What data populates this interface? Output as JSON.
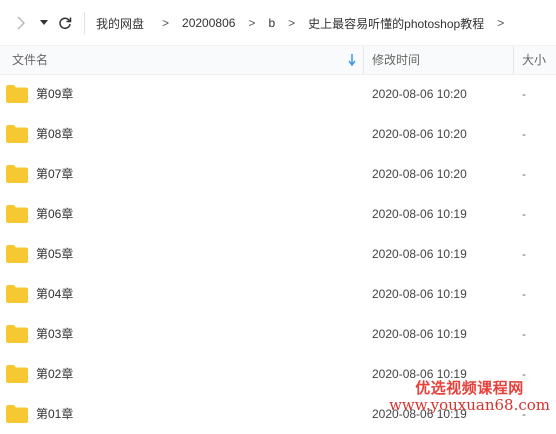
{
  "toolbar": {
    "forward_icon": "chevron-right-icon",
    "dropdown_icon": "caret-down-icon",
    "refresh_icon": "refresh-icon"
  },
  "breadcrumb": {
    "items": [
      "我的网盘",
      "20200806",
      "b",
      "史上最容易听懂的photoshop教程"
    ],
    "separator": ">"
  },
  "columns": {
    "name": "文件名",
    "modified": "修改时间",
    "size": "大小"
  },
  "files": [
    {
      "name": "第09章",
      "modified": "2020-08-06 10:20",
      "size": "-"
    },
    {
      "name": "第08章",
      "modified": "2020-08-06 10:20",
      "size": "-"
    },
    {
      "name": "第07章",
      "modified": "2020-08-06 10:20",
      "size": "-"
    },
    {
      "name": "第06章",
      "modified": "2020-08-06 10:19",
      "size": "-"
    },
    {
      "name": "第05章",
      "modified": "2020-08-06 10:19",
      "size": "-"
    },
    {
      "name": "第04章",
      "modified": "2020-08-06 10:19",
      "size": "-"
    },
    {
      "name": "第03章",
      "modified": "2020-08-06 10:19",
      "size": "-"
    },
    {
      "name": "第02章",
      "modified": "2020-08-06 10:19",
      "size": "-"
    },
    {
      "name": "第01章",
      "modified": "2020-08-06 10:19",
      "size": "-"
    }
  ],
  "watermark": {
    "line1": "优选视频课程网",
    "line2": "www.youxuan68.com"
  },
  "colors": {
    "folder": "#f8c833",
    "sort_arrow": "#2f8cf0",
    "watermark": "#e8403a"
  }
}
